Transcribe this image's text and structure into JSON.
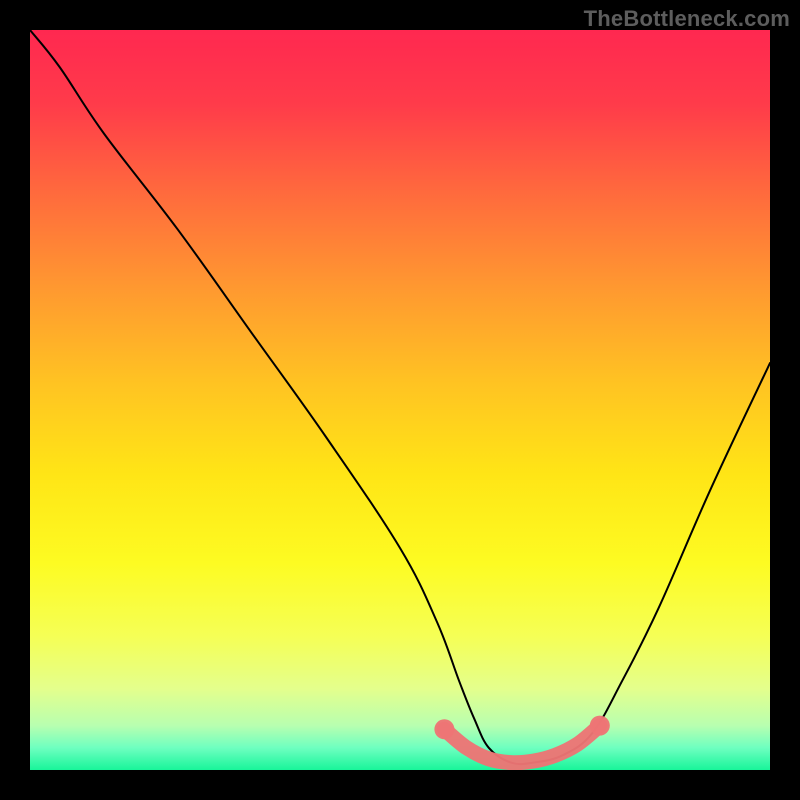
{
  "attribution": "TheBottleneck.com",
  "colors": {
    "bg_black": "#000000",
    "curve": "#000000",
    "marker": "#ed7575"
  },
  "gradient_stops": [
    {
      "offset": 0.0,
      "color": "#ff2850"
    },
    {
      "offset": 0.1,
      "color": "#ff3b4a"
    },
    {
      "offset": 0.22,
      "color": "#ff6a3d"
    },
    {
      "offset": 0.35,
      "color": "#ff9930"
    },
    {
      "offset": 0.48,
      "color": "#ffc422"
    },
    {
      "offset": 0.6,
      "color": "#ffe516"
    },
    {
      "offset": 0.72,
      "color": "#fdfb22"
    },
    {
      "offset": 0.82,
      "color": "#f5ff56"
    },
    {
      "offset": 0.89,
      "color": "#e4ff8c"
    },
    {
      "offset": 0.94,
      "color": "#b8ffb0"
    },
    {
      "offset": 0.97,
      "color": "#6effc0"
    },
    {
      "offset": 1.0,
      "color": "#18f59a"
    }
  ],
  "chart_data": {
    "type": "line",
    "title": "",
    "xlabel": "",
    "ylabel": "",
    "xlim": [
      0,
      100
    ],
    "ylim": [
      0,
      100
    ],
    "series": [
      {
        "name": "bottleneck-curve",
        "x": [
          0,
          4,
          10,
          20,
          30,
          40,
          50,
          55,
          58,
          60,
          62,
          65,
          68,
          72,
          76,
          80,
          85,
          92,
          100
        ],
        "values": [
          100,
          95,
          86,
          73,
          59,
          45,
          30,
          20,
          12,
          7,
          3,
          1,
          1,
          2,
          5,
          12,
          22,
          38,
          55
        ]
      }
    ],
    "markers": {
      "name": "optimal-range",
      "points": [
        {
          "x": 56,
          "y": 5.5
        },
        {
          "x": 59,
          "y": 3.0
        },
        {
          "x": 62,
          "y": 1.5
        },
        {
          "x": 65,
          "y": 1.0
        },
        {
          "x": 68,
          "y": 1.2
        },
        {
          "x": 71,
          "y": 2.0
        },
        {
          "x": 74,
          "y": 3.5
        },
        {
          "x": 77,
          "y": 6.0
        }
      ]
    }
  }
}
